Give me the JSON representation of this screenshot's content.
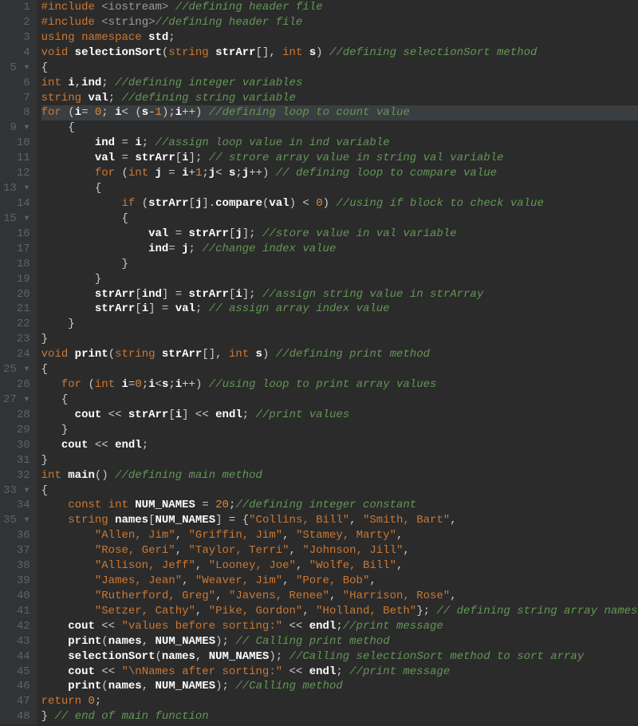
{
  "lines": [
    {
      "n": "1",
      "fold": "",
      "code": [
        [
          "inc",
          "#include "
        ],
        [
          "sysh",
          "<iostream>"
        ],
        [
          "txt",
          " "
        ],
        [
          "cm",
          "//defining header file"
        ]
      ]
    },
    {
      "n": "2",
      "fold": "",
      "code": [
        [
          "inc",
          "#include "
        ],
        [
          "sysh",
          "<string>"
        ],
        [
          "cm",
          "//defining header file"
        ]
      ]
    },
    {
      "n": "3",
      "fold": "",
      "code": [
        [
          "kw",
          "using namespace "
        ],
        [
          "white",
          "std"
        ],
        [
          "txt",
          ";"
        ]
      ]
    },
    {
      "n": "4",
      "fold": "",
      "code": [
        [
          "kw",
          "void "
        ],
        [
          "white",
          "selectionSort"
        ],
        [
          "txt",
          "("
        ],
        [
          "kw",
          "string "
        ],
        [
          "white",
          "strArr"
        ],
        [
          "txt",
          "[], "
        ],
        [
          "kw",
          "int "
        ],
        [
          "white",
          "s"
        ],
        [
          "txt",
          ") "
        ],
        [
          "cm",
          "//defining selectionSort method"
        ]
      ]
    },
    {
      "n": "5",
      "fold": "▾",
      "code": [
        [
          "txt",
          "{"
        ]
      ]
    },
    {
      "n": "6",
      "fold": "",
      "code": [
        [
          "kw",
          "int "
        ],
        [
          "white",
          "i"
        ],
        [
          "txt",
          ","
        ],
        [
          "white",
          "ind"
        ],
        [
          "txt",
          "; "
        ],
        [
          "cm",
          "//defining integer variables"
        ]
      ]
    },
    {
      "n": "7",
      "fold": "",
      "code": [
        [
          "kw",
          "string "
        ],
        [
          "white",
          "val"
        ],
        [
          "txt",
          "; "
        ],
        [
          "cm",
          "//defining string variable"
        ]
      ]
    },
    {
      "n": "8",
      "fold": "",
      "current": true,
      "code": [
        [
          "kw",
          "for "
        ],
        [
          "txt",
          "("
        ],
        [
          "white",
          "i"
        ],
        [
          "txt",
          "= "
        ],
        [
          "num2",
          "0"
        ],
        [
          "txt",
          "; "
        ],
        [
          "white",
          "i"
        ],
        [
          "txt",
          "< ("
        ],
        [
          "white",
          "s"
        ],
        [
          "txt",
          "-"
        ],
        [
          "num2",
          "1"
        ],
        [
          "txt",
          ");"
        ],
        [
          "white",
          "i"
        ],
        [
          "txt",
          "++) "
        ],
        [
          "cm",
          "//defining loop to count value"
        ]
      ]
    },
    {
      "n": "9",
      "fold": "▾",
      "code": [
        [
          "txt",
          "    {"
        ]
      ]
    },
    {
      "n": "10",
      "fold": "",
      "code": [
        [
          "txt",
          "        "
        ],
        [
          "white",
          "ind"
        ],
        [
          "txt",
          " = "
        ],
        [
          "white",
          "i"
        ],
        [
          "txt",
          "; "
        ],
        [
          "cm",
          "//assign loop value in ind variable"
        ]
      ]
    },
    {
      "n": "11",
      "fold": "",
      "code": [
        [
          "txt",
          "        "
        ],
        [
          "white",
          "val"
        ],
        [
          "txt",
          " = "
        ],
        [
          "white",
          "strArr"
        ],
        [
          "txt",
          "["
        ],
        [
          "white",
          "i"
        ],
        [
          "txt",
          "]; "
        ],
        [
          "cm",
          "// strore array value in string val variable"
        ]
      ]
    },
    {
      "n": "12",
      "fold": "",
      "code": [
        [
          "txt",
          "        "
        ],
        [
          "kw",
          "for "
        ],
        [
          "txt",
          "("
        ],
        [
          "kw",
          "int "
        ],
        [
          "white",
          "j"
        ],
        [
          "txt",
          " = "
        ],
        [
          "white",
          "i"
        ],
        [
          "txt",
          "+"
        ],
        [
          "num2",
          "1"
        ],
        [
          "txt",
          ";"
        ],
        [
          "white",
          "j"
        ],
        [
          "txt",
          "< "
        ],
        [
          "white",
          "s"
        ],
        [
          "txt",
          ";"
        ],
        [
          "white",
          "j"
        ],
        [
          "txt",
          "++) "
        ],
        [
          "cm",
          "// defining loop to compare value"
        ]
      ]
    },
    {
      "n": "13",
      "fold": "▾",
      "code": [
        [
          "txt",
          "        {"
        ]
      ]
    },
    {
      "n": "14",
      "fold": "",
      "code": [
        [
          "txt",
          "            "
        ],
        [
          "kw",
          "if "
        ],
        [
          "txt",
          "("
        ],
        [
          "white",
          "strArr"
        ],
        [
          "txt",
          "["
        ],
        [
          "white",
          "j"
        ],
        [
          "txt",
          "]."
        ],
        [
          "white",
          "compare"
        ],
        [
          "txt",
          "("
        ],
        [
          "white",
          "val"
        ],
        [
          "txt",
          ") < "
        ],
        [
          "num2",
          "0"
        ],
        [
          "txt",
          ") "
        ],
        [
          "cm",
          "//using if block to check value"
        ]
      ]
    },
    {
      "n": "15",
      "fold": "▾",
      "code": [
        [
          "txt",
          "            {"
        ]
      ]
    },
    {
      "n": "16",
      "fold": "",
      "code": [
        [
          "txt",
          "                "
        ],
        [
          "white",
          "val"
        ],
        [
          "txt",
          " = "
        ],
        [
          "white",
          "strArr"
        ],
        [
          "txt",
          "["
        ],
        [
          "white",
          "j"
        ],
        [
          "txt",
          "]; "
        ],
        [
          "cm",
          "//store value in val variable"
        ]
      ]
    },
    {
      "n": "17",
      "fold": "",
      "code": [
        [
          "txt",
          "                "
        ],
        [
          "white",
          "ind"
        ],
        [
          "txt",
          "= "
        ],
        [
          "white",
          "j"
        ],
        [
          "txt",
          "; "
        ],
        [
          "cm",
          "//change index value"
        ]
      ]
    },
    {
      "n": "18",
      "fold": "",
      "code": [
        [
          "txt",
          "            }"
        ]
      ]
    },
    {
      "n": "19",
      "fold": "",
      "code": [
        [
          "txt",
          "        }"
        ]
      ]
    },
    {
      "n": "20",
      "fold": "",
      "code": [
        [
          "txt",
          "        "
        ],
        [
          "white",
          "strArr"
        ],
        [
          "txt",
          "["
        ],
        [
          "white",
          "ind"
        ],
        [
          "txt",
          "] = "
        ],
        [
          "white",
          "strArr"
        ],
        [
          "txt",
          "["
        ],
        [
          "white",
          "i"
        ],
        [
          "txt",
          "]; "
        ],
        [
          "cm",
          "//assign string value in strArray"
        ]
      ]
    },
    {
      "n": "21",
      "fold": "",
      "code": [
        [
          "txt",
          "        "
        ],
        [
          "white",
          "strArr"
        ],
        [
          "txt",
          "["
        ],
        [
          "white",
          "i"
        ],
        [
          "txt",
          "] = "
        ],
        [
          "white",
          "val"
        ],
        [
          "txt",
          "; "
        ],
        [
          "cm",
          "// assign array index value"
        ]
      ]
    },
    {
      "n": "22",
      "fold": "",
      "code": [
        [
          "txt",
          "    }"
        ]
      ]
    },
    {
      "n": "23",
      "fold": "",
      "code": [
        [
          "txt",
          "}"
        ]
      ]
    },
    {
      "n": "24",
      "fold": "",
      "code": [
        [
          "kw",
          "void "
        ],
        [
          "white",
          "print"
        ],
        [
          "txt",
          "("
        ],
        [
          "kw",
          "string "
        ],
        [
          "white",
          "strArr"
        ],
        [
          "txt",
          "[], "
        ],
        [
          "kw",
          "int "
        ],
        [
          "white",
          "s"
        ],
        [
          "txt",
          ") "
        ],
        [
          "cm",
          "//defining print method"
        ]
      ]
    },
    {
      "n": "25",
      "fold": "▾",
      "code": [
        [
          "txt",
          "{"
        ]
      ]
    },
    {
      "n": "26",
      "fold": "",
      "code": [
        [
          "txt",
          "   "
        ],
        [
          "kw",
          "for "
        ],
        [
          "txt",
          "("
        ],
        [
          "kw",
          "int "
        ],
        [
          "white",
          "i"
        ],
        [
          "txt",
          "="
        ],
        [
          "num2",
          "0"
        ],
        [
          "txt",
          ";"
        ],
        [
          "white",
          "i"
        ],
        [
          "txt",
          "<"
        ],
        [
          "white",
          "s"
        ],
        [
          "txt",
          ";"
        ],
        [
          "white",
          "i"
        ],
        [
          "txt",
          "++) "
        ],
        [
          "cm",
          "//using loop to print array values"
        ]
      ]
    },
    {
      "n": "27",
      "fold": "▾",
      "code": [
        [
          "txt",
          "   {"
        ]
      ]
    },
    {
      "n": "28",
      "fold": "",
      "code": [
        [
          "txt",
          "     "
        ],
        [
          "white",
          "cout"
        ],
        [
          "txt",
          " << "
        ],
        [
          "white",
          "strArr"
        ],
        [
          "txt",
          "["
        ],
        [
          "white",
          "i"
        ],
        [
          "txt",
          "] << "
        ],
        [
          "white",
          "endl"
        ],
        [
          "txt",
          "; "
        ],
        [
          "cm",
          "//print values"
        ]
      ]
    },
    {
      "n": "29",
      "fold": "",
      "code": [
        [
          "txt",
          "   }"
        ]
      ]
    },
    {
      "n": "30",
      "fold": "",
      "code": [
        [
          "txt",
          "   "
        ],
        [
          "white",
          "cout"
        ],
        [
          "txt",
          " << "
        ],
        [
          "white",
          "endl"
        ],
        [
          "txt",
          ";"
        ]
      ]
    },
    {
      "n": "31",
      "fold": "",
      "code": [
        [
          "txt",
          "}"
        ]
      ]
    },
    {
      "n": "32",
      "fold": "",
      "code": [
        [
          "kw",
          "int "
        ],
        [
          "white",
          "main"
        ],
        [
          "txt",
          "() "
        ],
        [
          "cm",
          "//defining main method"
        ]
      ]
    },
    {
      "n": "33",
      "fold": "▾",
      "code": [
        [
          "txt",
          "{"
        ]
      ]
    },
    {
      "n": "34",
      "fold": "",
      "code": [
        [
          "txt",
          "    "
        ],
        [
          "kw",
          "const int "
        ],
        [
          "white",
          "NUM_NAMES"
        ],
        [
          "txt",
          " = "
        ],
        [
          "num2",
          "20"
        ],
        [
          "txt",
          ";"
        ],
        [
          "cm",
          "//defining integer constant"
        ]
      ]
    },
    {
      "n": "35",
      "fold": "▾",
      "code": [
        [
          "txt",
          "    "
        ],
        [
          "kw",
          "string "
        ],
        [
          "white",
          "names"
        ],
        [
          "txt",
          "["
        ],
        [
          "white",
          "NUM_NAMES"
        ],
        [
          "txt",
          "] = {"
        ],
        [
          "str",
          "\"Collins, Bill\""
        ],
        [
          "txt",
          ", "
        ],
        [
          "str",
          "\"Smith, Bart\""
        ],
        [
          "txt",
          ","
        ]
      ]
    },
    {
      "n": "36",
      "fold": "",
      "code": [
        [
          "txt",
          "        "
        ],
        [
          "str",
          "\"Allen, Jim\""
        ],
        [
          "txt",
          ", "
        ],
        [
          "str",
          "\"Griffin, Jim\""
        ],
        [
          "txt",
          ", "
        ],
        [
          "str",
          "\"Stamey, Marty\""
        ],
        [
          "txt",
          ","
        ]
      ]
    },
    {
      "n": "37",
      "fold": "",
      "code": [
        [
          "txt",
          "        "
        ],
        [
          "str",
          "\"Rose, Geri\""
        ],
        [
          "txt",
          ", "
        ],
        [
          "str",
          "\"Taylor, Terri\""
        ],
        [
          "txt",
          ", "
        ],
        [
          "str",
          "\"Johnson, Jill\""
        ],
        [
          "txt",
          ","
        ]
      ]
    },
    {
      "n": "38",
      "fold": "",
      "code": [
        [
          "txt",
          "        "
        ],
        [
          "str",
          "\"Allison, Jeff\""
        ],
        [
          "txt",
          ", "
        ],
        [
          "str",
          "\"Looney, Joe\""
        ],
        [
          "txt",
          ", "
        ],
        [
          "str",
          "\"Wolfe, Bill\""
        ],
        [
          "txt",
          ","
        ]
      ]
    },
    {
      "n": "39",
      "fold": "",
      "code": [
        [
          "txt",
          "        "
        ],
        [
          "str",
          "\"James, Jean\""
        ],
        [
          "txt",
          ", "
        ],
        [
          "str",
          "\"Weaver, Jim\""
        ],
        [
          "txt",
          ", "
        ],
        [
          "str",
          "\"Pore, Bob\""
        ],
        [
          "txt",
          ","
        ]
      ]
    },
    {
      "n": "40",
      "fold": "",
      "code": [
        [
          "txt",
          "        "
        ],
        [
          "str",
          "\"Rutherford, Greg\""
        ],
        [
          "txt",
          ", "
        ],
        [
          "str",
          "\"Javens, Renee\""
        ],
        [
          "txt",
          ", "
        ],
        [
          "str",
          "\"Harrison, Rose\""
        ],
        [
          "txt",
          ","
        ]
      ]
    },
    {
      "n": "41",
      "fold": "",
      "code": [
        [
          "txt",
          "        "
        ],
        [
          "str",
          "\"Setzer, Cathy\""
        ],
        [
          "txt",
          ", "
        ],
        [
          "str",
          "\"Pike, Gordon\""
        ],
        [
          "txt",
          ", "
        ],
        [
          "str",
          "\"Holland, Beth\""
        ],
        [
          "txt",
          "}; "
        ],
        [
          "cm",
          "// defining string array names"
        ]
      ]
    },
    {
      "n": "42",
      "fold": "",
      "code": [
        [
          "txt",
          "    "
        ],
        [
          "white",
          "cout"
        ],
        [
          "txt",
          " << "
        ],
        [
          "str",
          "\"values before sorting:\""
        ],
        [
          "txt",
          " << "
        ],
        [
          "white",
          "endl"
        ],
        [
          "txt",
          ";"
        ],
        [
          "cm",
          "//print message"
        ]
      ]
    },
    {
      "n": "43",
      "fold": "",
      "code": [
        [
          "txt",
          "    "
        ],
        [
          "white",
          "print"
        ],
        [
          "txt",
          "("
        ],
        [
          "white",
          "names"
        ],
        [
          "txt",
          ", "
        ],
        [
          "white",
          "NUM_NAMES"
        ],
        [
          "txt",
          "); "
        ],
        [
          "cm",
          "// Calling print method"
        ]
      ]
    },
    {
      "n": "44",
      "fold": "",
      "code": [
        [
          "txt",
          "    "
        ],
        [
          "white",
          "selectionSort"
        ],
        [
          "txt",
          "("
        ],
        [
          "white",
          "names"
        ],
        [
          "txt",
          ", "
        ],
        [
          "white",
          "NUM_NAMES"
        ],
        [
          "txt",
          "); "
        ],
        [
          "cm",
          "//Calling selectionSort method to sort array"
        ]
      ]
    },
    {
      "n": "45",
      "fold": "",
      "code": [
        [
          "txt",
          "    "
        ],
        [
          "white",
          "cout"
        ],
        [
          "txt",
          " << "
        ],
        [
          "str",
          "\"\\nNames after sorting:\""
        ],
        [
          "txt",
          " << "
        ],
        [
          "white",
          "endl"
        ],
        [
          "txt",
          "; "
        ],
        [
          "cm",
          "//print message"
        ]
      ]
    },
    {
      "n": "46",
      "fold": "",
      "code": [
        [
          "txt",
          "    "
        ],
        [
          "white",
          "print"
        ],
        [
          "txt",
          "("
        ],
        [
          "white",
          "names"
        ],
        [
          "txt",
          ", "
        ],
        [
          "white",
          "NUM_NAMES"
        ],
        [
          "txt",
          "); "
        ],
        [
          "cm",
          "//Calling method"
        ]
      ]
    },
    {
      "n": "47",
      "fold": "",
      "code": [
        [
          "kw",
          "return "
        ],
        [
          "num2",
          "0"
        ],
        [
          "txt",
          ";"
        ]
      ]
    },
    {
      "n": "48",
      "fold": "",
      "code": [
        [
          "txt",
          "} "
        ],
        [
          "cm",
          "// end of main function"
        ]
      ]
    }
  ]
}
